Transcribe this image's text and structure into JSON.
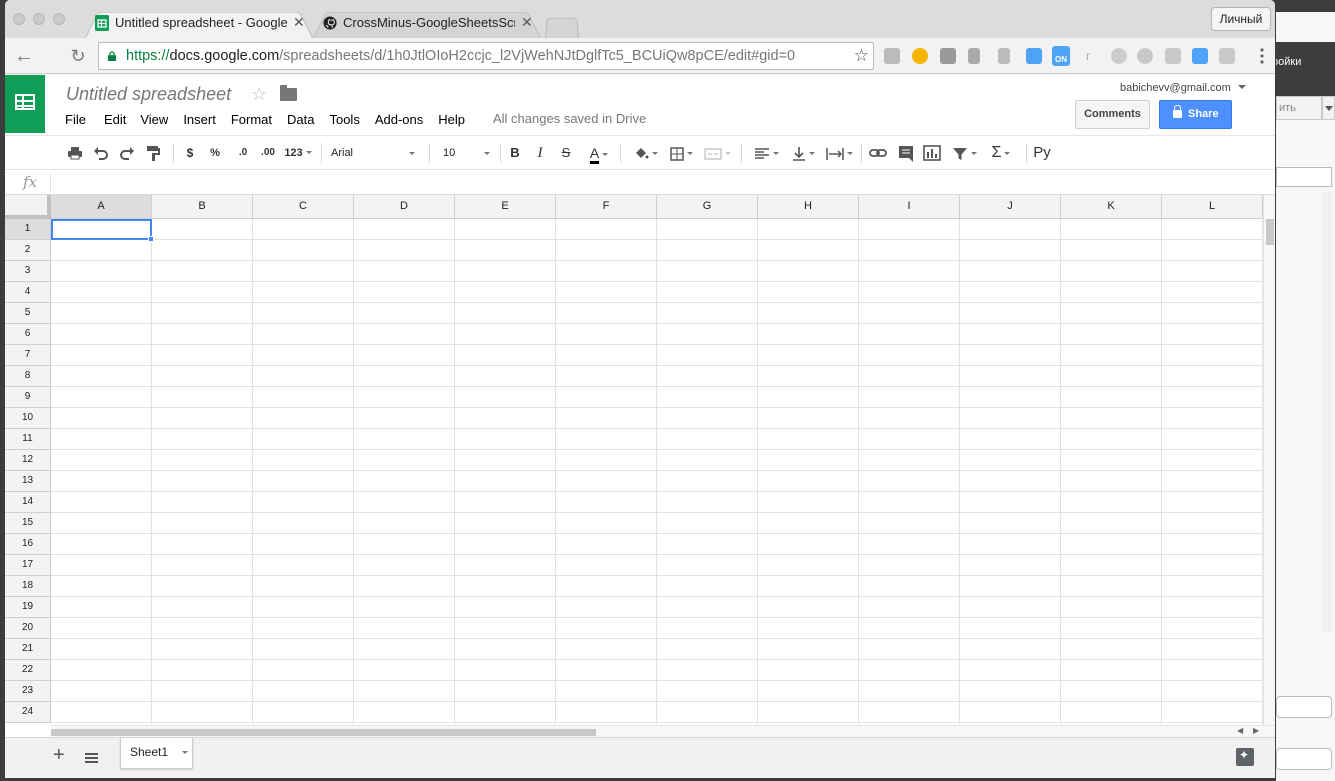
{
  "browser": {
    "tabs": [
      {
        "title": "Untitled spreadsheet - Google Sheets",
        "favicon": "sheets-icon",
        "active": true
      },
      {
        "title": "CrossMinus-GoogleSheetsScript",
        "favicon": "github-icon",
        "active": false
      }
    ],
    "profile_label": "Личный",
    "url": {
      "scheme": "https://",
      "host": "docs.google.com",
      "path": "/spreadsheets/d/1h0JtlOIoH2ccjc_l2VjWehNJtDglfTc5_BCUiQw8pCE/edit#gid=0"
    },
    "extension_badge": "ON"
  },
  "sheets": {
    "doc_title": "Untitled spreadsheet",
    "menu": [
      "File",
      "Edit",
      "View",
      "Insert",
      "Format",
      "Data",
      "Tools",
      "Add-ons",
      "Help"
    ],
    "save_status": "All changes saved in Drive",
    "account_email": "babichevv@gmail.com",
    "comments_label": "Comments",
    "share_label": "Share",
    "toolbar": {
      "currency": "$",
      "percent": "%",
      "decrease_decimal": ".0",
      "increase_decimal": ".00",
      "more_formats": "123",
      "font": "Arial",
      "font_size": "10",
      "bold": "B",
      "italic": "I",
      "strikethrough": "S",
      "text_color": "A",
      "input_tools": "Ру"
    },
    "fx_label": "fx",
    "columns": [
      "A",
      "B",
      "C",
      "D",
      "E",
      "F",
      "G",
      "H",
      "I",
      "J",
      "K",
      "L"
    ],
    "rows": [
      "1",
      "2",
      "3",
      "4",
      "5",
      "6",
      "7",
      "8",
      "9",
      "10",
      "11",
      "12",
      "13",
      "14",
      "15",
      "16",
      "17",
      "18",
      "19",
      "20",
      "21",
      "22",
      "23",
      "24"
    ],
    "active_cell": "A1",
    "sheet_tab": "Sheet1"
  },
  "background_window": {
    "partial_text": "ройки",
    "partial_button": "ить"
  },
  "colors": {
    "sheets_green": "#0f9d58",
    "share_blue": "#4d90fe",
    "selection_blue": "#4285f4",
    "url_green": "#0b8043"
  }
}
